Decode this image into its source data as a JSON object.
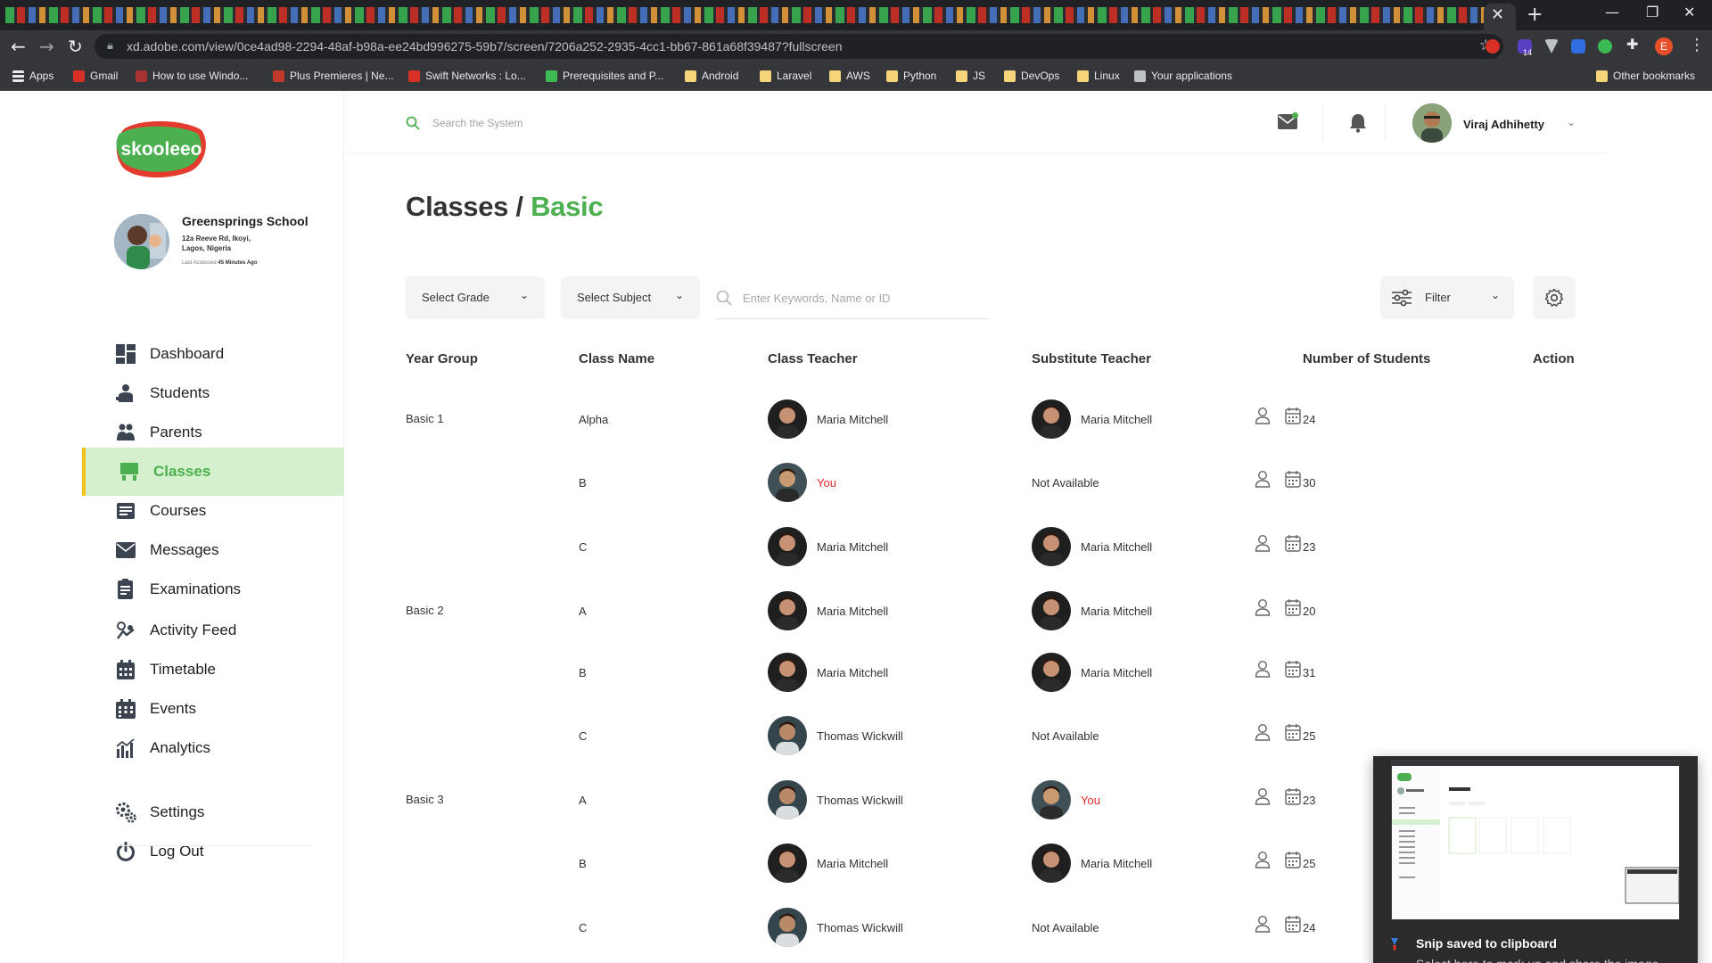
{
  "browser": {
    "url": "xd.adobe.com/view/0ce4ad98-2294-48af-b98a-ee24bd996275-59b7/screen/7206a252-2935-4cc1-bb67-861a68f39487?fullscreen",
    "bookmarks": [
      {
        "label": "Apps",
        "icon": "apps-grid-icon"
      },
      {
        "label": "Gmail",
        "icon": "gmail-icon"
      },
      {
        "label": "How to use Windo...",
        "icon": "site-icon"
      },
      {
        "label": "Plus Premieres | Ne...",
        "icon": "chart-site-icon"
      },
      {
        "label": "Swift Networks : Lo...",
        "icon": "site-icon"
      },
      {
        "label": "Prerequisites and P...",
        "icon": "site-icon"
      },
      {
        "label": "Android",
        "icon": "folder-icon"
      },
      {
        "label": "Laravel",
        "icon": "folder-icon"
      },
      {
        "label": "AWS",
        "icon": "folder-icon"
      },
      {
        "label": "Python",
        "icon": "folder-icon"
      },
      {
        "label": "JS",
        "icon": "folder-icon"
      },
      {
        "label": "DevOps",
        "icon": "folder-icon"
      },
      {
        "label": "Linux",
        "icon": "folder-icon"
      },
      {
        "label": "Your applications",
        "icon": "site-icon"
      }
    ],
    "other_bookmarks": "Other bookmarks",
    "profile_initial": "E",
    "ext_badge": "14"
  },
  "brand": {
    "logo_text": "skooleeo",
    "accent": "#4cb050",
    "logo_bg": "#e33b2e",
    "highlight_bar": "#f1c21b"
  },
  "school": {
    "name": "Greensprings School",
    "address_line1": "12a Reeve Rd, Ikoyi,",
    "address_line2": "Lagos, Nigeria",
    "last_accessed_label": "Last Accessed",
    "last_accessed_value": "45 Minutes Ago"
  },
  "sidebar": {
    "items": [
      {
        "label": "Dashboard",
        "icon": "dashboard-icon"
      },
      {
        "label": "Students",
        "icon": "students-icon"
      },
      {
        "label": "Parents",
        "icon": "parents-icon"
      },
      {
        "label": "Classes",
        "icon": "classes-icon",
        "active": true
      },
      {
        "label": "Courses",
        "icon": "courses-icon"
      },
      {
        "label": "Messages",
        "icon": "messages-icon"
      },
      {
        "label": "Examinations",
        "icon": "examinations-icon"
      },
      {
        "label": "Activity Feed",
        "icon": "activity-feed-icon"
      },
      {
        "label": "Timetable",
        "icon": "timetable-icon"
      },
      {
        "label": "Events",
        "icon": "events-icon"
      },
      {
        "label": "Analytics",
        "icon": "analytics-icon"
      }
    ],
    "footer": [
      {
        "label": "Settings",
        "icon": "settings-icon"
      },
      {
        "label": "Log Out",
        "icon": "logout-icon"
      }
    ]
  },
  "header": {
    "search_placeholder": "Search the System",
    "user_name": "Viraj Adhihetty"
  },
  "page": {
    "title_main": "Classes /",
    "title_accent": "Basic"
  },
  "filters": {
    "grade": "Select Grade",
    "subject": "Select Subject",
    "keyword_placeholder": "Enter Keywords, Name or ID",
    "filter": "Filter"
  },
  "table": {
    "headers": [
      "Year Group",
      "Class Name",
      "Class Teacher",
      "Substitute Teacher",
      "Number of Students",
      "Action"
    ],
    "rows": [
      {
        "year": "Basic 1",
        "class": "Alpha",
        "teacher": "Maria Mitchell",
        "teacher_av": "mm",
        "sub": "Maria Mitchell",
        "sub_av": "mm",
        "students": "24"
      },
      {
        "year": "",
        "class": "B",
        "teacher": "You",
        "teacher_av": "you",
        "sub": "Not Available",
        "sub_av": "",
        "students": "30"
      },
      {
        "year": "",
        "class": "C",
        "teacher": "Maria Mitchell",
        "teacher_av": "mm",
        "sub": "Maria Mitchell",
        "sub_av": "mm",
        "students": "23"
      },
      {
        "year": "Basic 2",
        "class": "A",
        "teacher": "Maria Mitchell",
        "teacher_av": "mm",
        "sub": "Maria Mitchell",
        "sub_av": "mm",
        "students": "20"
      },
      {
        "year": "",
        "class": "B",
        "teacher": "Maria Mitchell",
        "teacher_av": "mm",
        "sub": "Maria Mitchell",
        "sub_av": "mm",
        "students": "31"
      },
      {
        "year": "",
        "class": "C",
        "teacher": "Thomas Wickwill",
        "teacher_av": "tw",
        "sub": "Not Available",
        "sub_av": "",
        "students": "25"
      },
      {
        "year": "Basic 3",
        "class": "A",
        "teacher": "Thomas Wickwill",
        "teacher_av": "tw",
        "sub": "You",
        "sub_av": "you",
        "students": "23"
      },
      {
        "year": "",
        "class": "B",
        "teacher": "Maria Mitchell",
        "teacher_av": "mm",
        "sub": "Maria Mitchell",
        "sub_av": "mm",
        "students": "25"
      },
      {
        "year": "",
        "class": "C",
        "teacher": "Thomas Wickwill",
        "teacher_av": "tw",
        "sub": "Not Available",
        "sub_av": "",
        "students": "24"
      }
    ]
  },
  "toast": {
    "title": "Snip saved to clipboard",
    "body": "Select here to mark up and share the image"
  }
}
